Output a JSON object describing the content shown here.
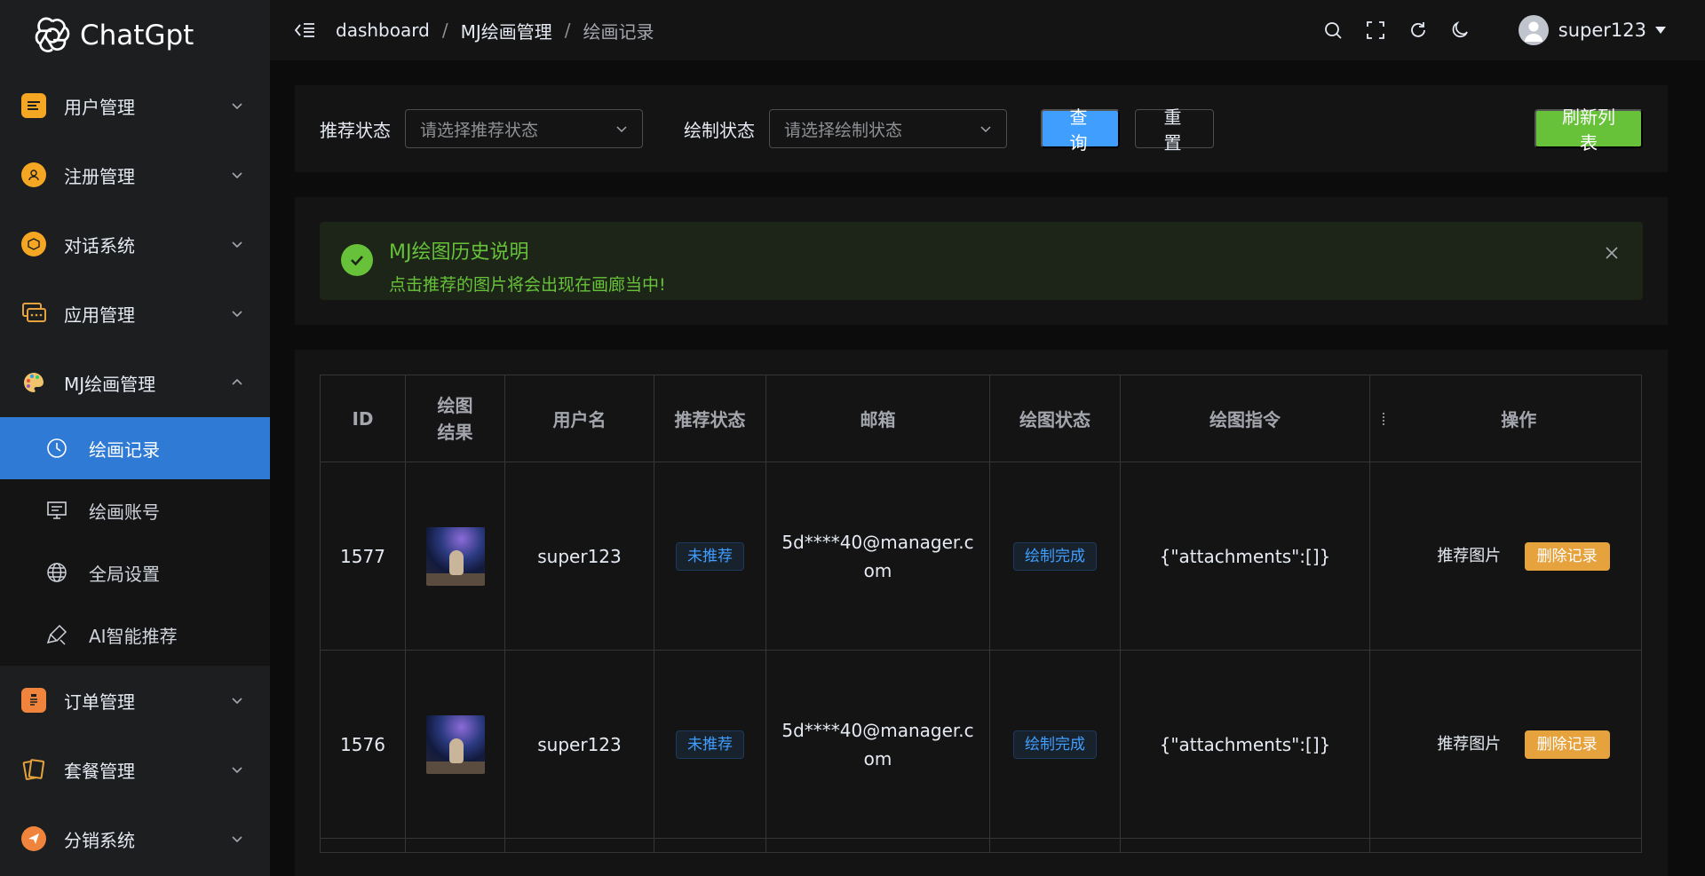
{
  "app": {
    "logo_text": "ChatGpt"
  },
  "colors": {
    "primary": "#409eff",
    "success": "#67c23a",
    "warning": "#e6a23c",
    "active_menu": "#2f7ad4"
  },
  "sidebar": {
    "items": [
      {
        "label": "用户管理",
        "icon": "user-manage-icon"
      },
      {
        "label": "注册管理",
        "icon": "register-icon"
      },
      {
        "label": "对话系统",
        "icon": "chat-system-icon"
      },
      {
        "label": "应用管理",
        "icon": "app-manage-icon"
      },
      {
        "label": "MJ绘画管理",
        "icon": "palette-icon"
      },
      {
        "label": "订单管理",
        "icon": "order-icon"
      },
      {
        "label": "套餐管理",
        "icon": "package-icon"
      },
      {
        "label": "分销系统",
        "icon": "distribution-icon"
      }
    ],
    "submenu": [
      {
        "label": "绘画记录",
        "icon": "clock-icon"
      },
      {
        "label": "绘画账号",
        "icon": "monitor-icon"
      },
      {
        "label": "全局设置",
        "icon": "globe-icon"
      },
      {
        "label": "AI智能推荐",
        "icon": "brush-icon"
      }
    ]
  },
  "header": {
    "breadcrumb": [
      "dashboard",
      "MJ绘画管理",
      "绘画记录"
    ],
    "separator": "/",
    "username": "super123"
  },
  "filter": {
    "recommend_label": "推荐状态",
    "recommend_placeholder": "请选择推荐状态",
    "draw_label": "绘制状态",
    "draw_placeholder": "请选择绘制状态",
    "query_button": "查询",
    "reset_button": "重置",
    "refresh_button": "刷新列表"
  },
  "alert": {
    "title": "MJ绘图历史说明",
    "description": "点击推荐的图片将会出现在画廊当中!"
  },
  "table": {
    "columns": [
      "ID",
      "绘图结果",
      "用户名",
      "推荐状态",
      "邮箱",
      "绘图状态",
      "绘图指令",
      "",
      "操作"
    ],
    "rows": [
      {
        "id": "1577",
        "username": "super123",
        "recommend": "未推荐",
        "email_line1": "5d****40@manager.c",
        "email_line2": "om",
        "status": "绘制完成",
        "command": "{\"attachments\":[]}",
        "op_recommend": "推荐图片",
        "op_delete": "删除记录"
      },
      {
        "id": "1576",
        "username": "super123",
        "recommend": "未推荐",
        "email_line1": "5d****40@manager.c",
        "email_line2": "om",
        "status": "绘制完成",
        "command": "{\"attachments\":[]}",
        "op_recommend": "推荐图片",
        "op_delete": "删除记录"
      }
    ]
  }
}
